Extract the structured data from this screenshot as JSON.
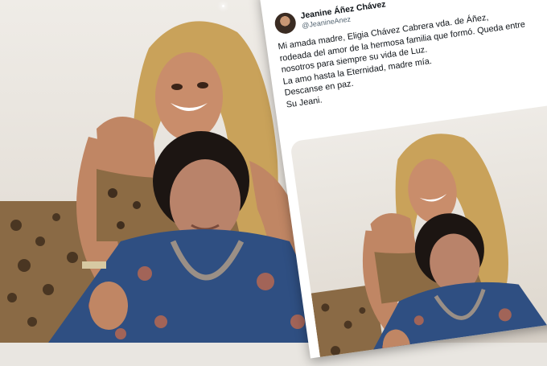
{
  "background_photo": {
    "icon": "photo-mother-daughter"
  },
  "tweet": {
    "display_name": "Jeanine Áñez Chávez",
    "handle": "@JeanineAnez",
    "lines": [
      "Mi amada madre, Eligia Chávez Cabrera vda. de Áñez, ",
      "rodeada del amor de la hermosa familia que formó. Queda entre",
      "nosotros para siempre su vida de Luz.",
      "La amo hasta la Eternidad, madre mía.",
      "Descanse en paz.",
      "Su Jeani."
    ]
  },
  "embedded_photo": {
    "icon": "photo-mother-daughter"
  }
}
